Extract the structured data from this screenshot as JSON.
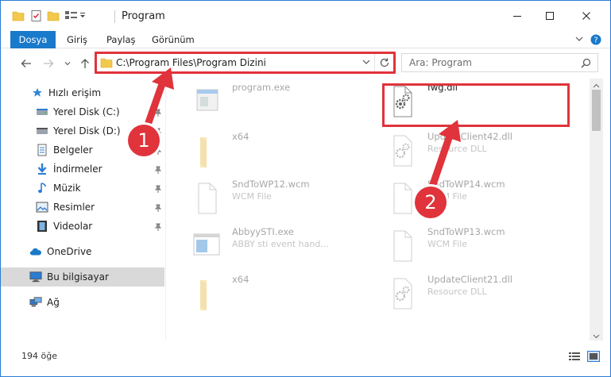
{
  "window": {
    "title": "Program"
  },
  "ribbon": {
    "tabs": [
      "Dosya",
      "Giriş",
      "Paylaş",
      "Görünüm"
    ]
  },
  "address": {
    "path": "C:\\Program Files\\Program Dizini"
  },
  "search": {
    "placeholder": "Ara: Program"
  },
  "sidebar": {
    "items": [
      {
        "label": "Hızlı erişim",
        "icon": "star-icon"
      },
      {
        "label": "Yerel Disk (C:)",
        "icon": "drive-icon"
      },
      {
        "label": "Yerel Disk (D:)",
        "icon": "drive-icon"
      },
      {
        "label": "Belgeler",
        "icon": "documents-icon"
      },
      {
        "label": "İndirmeler",
        "icon": "download-icon"
      },
      {
        "label": "Müzik",
        "icon": "music-icon"
      },
      {
        "label": "Resimler",
        "icon": "pictures-icon"
      },
      {
        "label": "Videolar",
        "icon": "videos-icon"
      },
      {
        "label": "OneDrive",
        "icon": "cloud-icon"
      },
      {
        "label": "Bu bilgisayar",
        "icon": "computer-icon"
      },
      {
        "label": "Ağ",
        "icon": "network-icon"
      }
    ]
  },
  "files": [
    {
      "name": "program.exe",
      "desc": "",
      "type": "exe"
    },
    {
      "name": "fwg.dll",
      "desc": "",
      "type": "dll"
    },
    {
      "name": "x64",
      "desc": "",
      "type": "folder"
    },
    {
      "name": "UpdateClient42.dll",
      "desc": "Resource DLL",
      "type": "dll"
    },
    {
      "name": "SndToWP12.wcm",
      "desc": "WCM File",
      "type": "file"
    },
    {
      "name": "SndToWP14.wcm",
      "desc": "WCM File",
      "type": "file"
    },
    {
      "name": "AbbyySTI.exe",
      "desc": "ABBY sti event hand...",
      "type": "exe-window"
    },
    {
      "name": "SndToWP13.wcm",
      "desc": "WCM File",
      "type": "file"
    },
    {
      "name": "x64",
      "desc": "",
      "type": "folder"
    },
    {
      "name": "UpdateClient21.dll",
      "desc": "Resource DLL",
      "type": "dll"
    }
  ],
  "status": {
    "count": "194 öğe"
  },
  "callouts": {
    "one": "1",
    "two": "2"
  },
  "colors": {
    "accent": "#1979ca",
    "highlight": "#e0333b"
  }
}
